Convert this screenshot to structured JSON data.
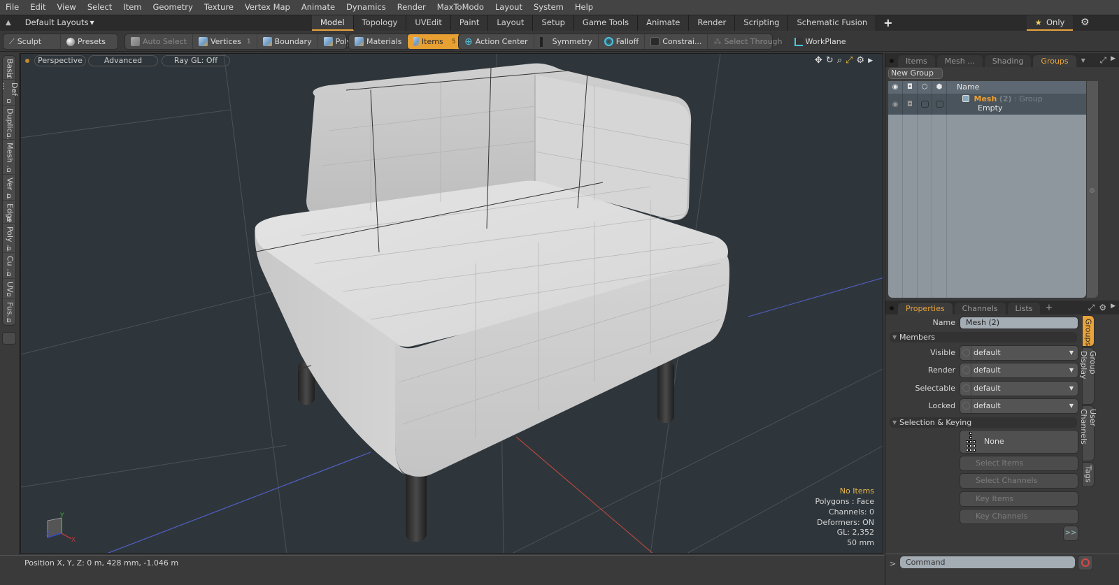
{
  "menu": [
    "File",
    "Edit",
    "View",
    "Select",
    "Item",
    "Geometry",
    "Texture",
    "Vertex Map",
    "Animate",
    "Dynamics",
    "Render",
    "MaxToModo",
    "Layout",
    "System",
    "Help"
  ],
  "layoutbar": {
    "layouts_label": "Default Layouts",
    "tabs": [
      "Model",
      "Topology",
      "UVEdit",
      "Paint",
      "Layout",
      "Setup",
      "Game Tools",
      "Animate",
      "Render",
      "Scripting",
      "Schematic Fusion"
    ],
    "active_tab": "Model",
    "only_label": "Only"
  },
  "toolbar": {
    "sculpt": "Sculpt",
    "presets": "Presets",
    "auto_select": "Auto Select",
    "vertices": "Vertices",
    "vertices_count": "1",
    "boundary": "Boundary",
    "polygons": "Polygons",
    "materials": "Materials",
    "items": "Items",
    "items_count": "5",
    "action_center": "Action Center",
    "symmetry": "Symmetry",
    "falloff": "Falloff",
    "constraints": "Constrai...",
    "select_through": "Select Through",
    "workplane": "WorkPlane"
  },
  "left_tabs": [
    "Basic",
    "Def ...",
    "Duplic...",
    "Mesh ...",
    "Ver ...",
    "Edge",
    "Poly ...",
    "Cu ...",
    "UV",
    "Fus..."
  ],
  "viewport": {
    "view_mode": "Perspective",
    "shading": "Advanced",
    "raygl": "Ray GL: Off",
    "info": {
      "selection": "No Items",
      "polygons": "Polygons : Face",
      "channels": "Channels: 0",
      "deformers": "Deformers: ON",
      "gl": "GL: 2,352",
      "scale": "50 mm"
    },
    "axis_labels": {
      "x": "X",
      "y": "Y",
      "z": "Z"
    }
  },
  "statusbar": {
    "position": "Position X, Y, Z:   0 m, 428 mm, -1.046 m"
  },
  "groups_panel": {
    "tabs": [
      "Items",
      "Mesh ...",
      "Shading",
      "Groups"
    ],
    "active_tab": "Groups",
    "new_group": "New Group",
    "column_name": "Name",
    "rows": [
      {
        "name": "Mesh",
        "count": "(2)",
        "type": ": Group",
        "sub": "Empty"
      }
    ]
  },
  "properties_panel": {
    "tabs": [
      "Properties",
      "Channels",
      "Lists"
    ],
    "active_tab": "Properties",
    "name_label": "Name",
    "name_value": "Mesh (2)",
    "members_section": "Members",
    "fields": [
      {
        "label": "Visible",
        "value": "default"
      },
      {
        "label": "Render",
        "value": "default"
      },
      {
        "label": "Selectable",
        "value": "default"
      },
      {
        "label": "Locked",
        "value": "default"
      }
    ],
    "selection_section": "Selection & Keying",
    "none_label": "None",
    "buttons": [
      "Select Items",
      "Select Channels",
      "Key Items",
      "Key Channels"
    ],
    "more": ">>",
    "side_tabs": [
      "Groups",
      "Group Display",
      "User Channels",
      "Tags"
    ],
    "active_side_tab": "Groups"
  },
  "command": {
    "prompt": ">",
    "placeholder": "Command"
  },
  "colors": {
    "accent": "#e8a33a",
    "viewport_bg": "#2f363b",
    "warn_text": "#e8b84a"
  }
}
